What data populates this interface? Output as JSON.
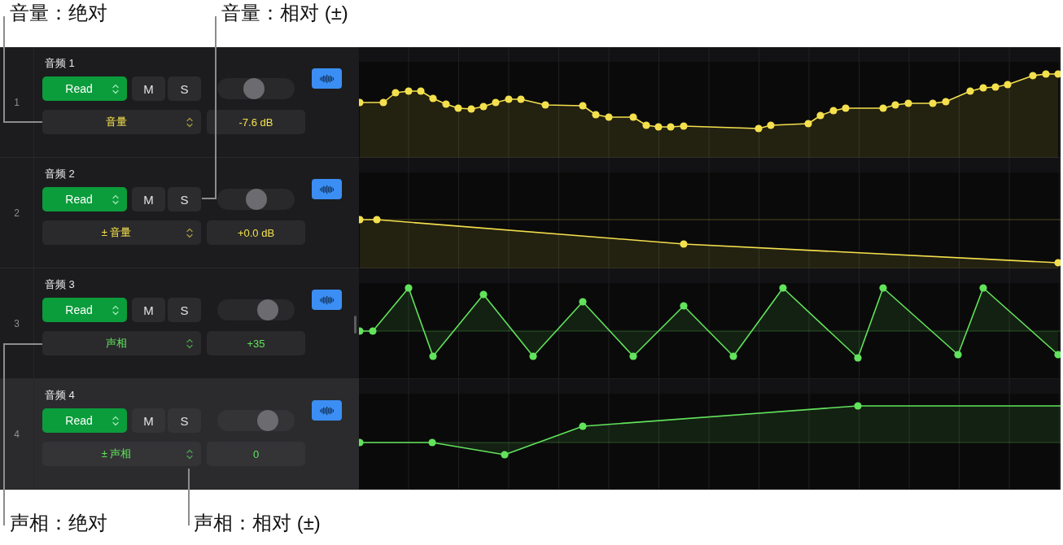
{
  "top_callouts": [
    "音量：绝对",
    "音量：相对 (±)"
  ],
  "tracks": [
    {
      "number": "1",
      "name": "音频 1",
      "selected": false,
      "mode": "Read",
      "mute": "M",
      "solo": "S",
      "level": 0.46,
      "parameter": "音量",
      "value": "-7.6 dB",
      "color": "#f4e04d"
    },
    {
      "number": "2",
      "name": "音频 2",
      "selected": false,
      "mode": "Read",
      "mute": "M",
      "solo": "S",
      "level": 0.51,
      "parameter": "± 音量",
      "value": "+0.0 dB",
      "color": "#f4e04d"
    },
    {
      "number": "3",
      "name": "音频 3",
      "selected": false,
      "mode": "Read",
      "mute": "M",
      "solo": "S",
      "level": 0.71,
      "parameter": "声相",
      "value": "+35",
      "color": "#62e35c"
    },
    {
      "number": "4",
      "name": "音频 4",
      "selected": true,
      "mode": "Read",
      "mute": "M",
      "solo": "S",
      "level": 0.71,
      "parameter": "± 声相",
      "value": "0",
      "color": "#62e35c"
    }
  ],
  "bottom_callouts": [
    "声相：绝对",
    "声相：相对 (±)"
  ]
}
